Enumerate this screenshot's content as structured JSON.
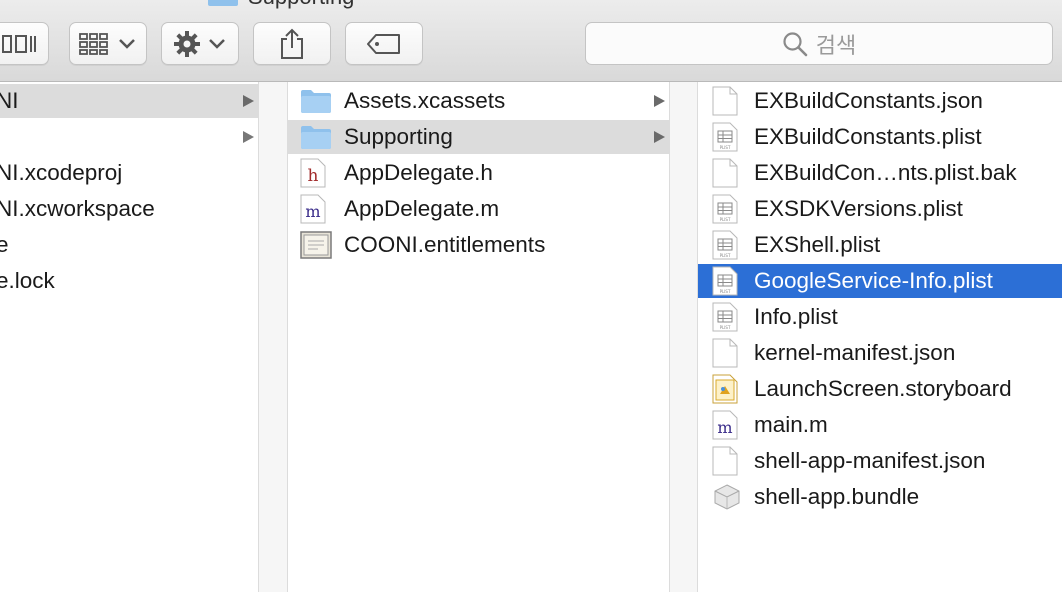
{
  "window": {
    "title": "Supporting"
  },
  "toolbar": {
    "search_placeholder": "검색"
  },
  "column1": {
    "items": [
      {
        "label": "NI",
        "has_arrow": true,
        "selected": true
      },
      {
        "label": "",
        "has_arrow": true,
        "selected": false
      },
      {
        "label": "NI.xcodeproj",
        "has_arrow": false,
        "selected": false
      },
      {
        "label": "NI.xcworkspace",
        "has_arrow": false,
        "selected": false
      },
      {
        "label": "e",
        "has_arrow": false,
        "selected": false
      },
      {
        "label": "e.lock",
        "has_arrow": false,
        "selected": false
      }
    ]
  },
  "column2": {
    "items": [
      {
        "label": "Assets.xcassets",
        "icon": "folder-icon"
      },
      {
        "label": "Supporting",
        "icon": "folder-icon"
      },
      {
        "label": "AppDelegate.h",
        "icon": "header-file-icon"
      },
      {
        "label": "AppDelegate.m",
        "icon": "objc-file-icon"
      },
      {
        "label": "COONI.entitlements",
        "icon": "certificate-icon"
      }
    ]
  },
  "column3": {
    "items": [
      {
        "label": "EXBuildConstants.json",
        "icon": "document-icon"
      },
      {
        "label": "EXBuildConstants.plist",
        "icon": "plist-icon"
      },
      {
        "label": "EXBuildCon…nts.plist.bak",
        "icon": "document-icon"
      },
      {
        "label": "EXSDKVersions.plist",
        "icon": "plist-icon"
      },
      {
        "label": "EXShell.plist",
        "icon": "plist-icon"
      },
      {
        "label": "GoogleService-Info.plist",
        "icon": "plist-icon"
      },
      {
        "label": "Info.plist",
        "icon": "plist-icon"
      },
      {
        "label": "kernel-manifest.json",
        "icon": "document-icon"
      },
      {
        "label": "LaunchScreen.storyboard",
        "icon": "storyboard-icon"
      },
      {
        "label": "main.m",
        "icon": "objc-file-icon"
      },
      {
        "label": "shell-app-manifest.json",
        "icon": "document-icon"
      },
      {
        "label": "shell-app.bundle",
        "icon": "bundle-icon"
      }
    ]
  },
  "colors": {
    "selection_blue": "#2c6fd6",
    "selection_gray": "#dcdcdc",
    "folder_blue": "#8fc1ec"
  }
}
